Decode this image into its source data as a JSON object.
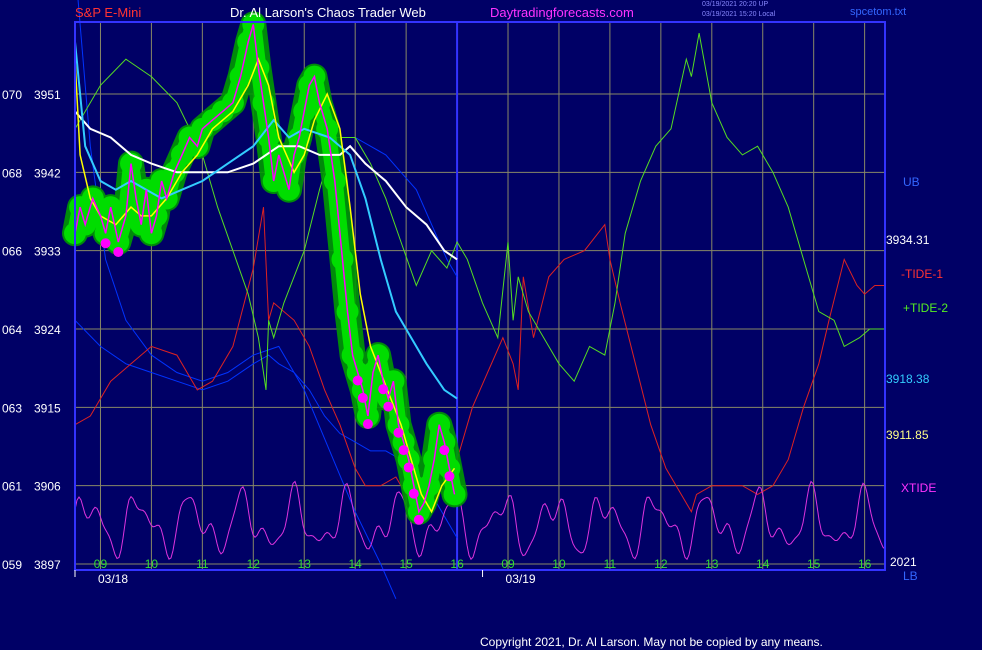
{
  "header": {
    "instrument": "S&P E-Mini",
    "title": "Dr. Al Larson's Chaos Trader Web",
    "site": "Daytradingforecasts.com",
    "stamp_line1": "03/19/2021 20:20 UP",
    "stamp_line2": "03/19/2021 15:20 Local",
    "filename": "spcetom.txt"
  },
  "footer": {
    "copyright": "Copyright 2021, Dr. Al Larson. May not be copied by any means."
  },
  "colors": {
    "background": "#000066",
    "plot_border": "#3333ff",
    "grid": "#888866",
    "price": "#ff00ff",
    "glow": "#00dd00",
    "glow_dark": "#009900",
    "yellow_avg": "#ffff00",
    "cyan_avg": "#33ccff",
    "white_avg": "#ffffff",
    "band": "#0033ff",
    "tide1": "#dd2222",
    "tide2": "#55dd22",
    "xtide": "#dd33dd"
  },
  "chart_data": {
    "type": "line",
    "y_axis": {
      "ticks": [
        {
          "left": "070",
          "right": "3951",
          "value": 3951
        },
        {
          "left": "068",
          "right": "3942",
          "value": 3942
        },
        {
          "left": "066",
          "right": "3933",
          "value": 3933
        },
        {
          "left": "064",
          "right": "3924",
          "value": 3924
        },
        {
          "left": "063",
          "right": "3915",
          "value": 3915
        },
        {
          "left": "061",
          "right": "3906",
          "value": 3906
        },
        {
          "left": "059",
          "right": "3897",
          "value": 3897
        }
      ],
      "ylim": [
        3897,
        3951
      ]
    },
    "x_axis": {
      "ticks": [
        "09",
        "10",
        "11",
        "12",
        "13",
        "14",
        "15",
        "16",
        "09",
        "10",
        "11",
        "12",
        "13",
        "14",
        "15",
        "16"
      ],
      "date_labels": [
        {
          "label": "03/18",
          "hour": 8.5
        },
        {
          "label": "03/19",
          "hour": 16.5
        }
      ],
      "xlim": [
        8.5,
        24.4
      ]
    },
    "right_labels": {
      "ub": "UB",
      "v1": "3934.31",
      "tide1": "-TIDE-1",
      "tide2": "+TIDE-2",
      "v2": "3918.38",
      "v3": "3911.85",
      "xtide": "XTIDE",
      "year": "2021",
      "lb": "LB"
    },
    "series": [
      {
        "key": "price",
        "x": [
          8.5,
          8.6,
          8.7,
          8.85,
          9.0,
          9.1,
          9.2,
          9.35,
          9.5,
          9.6,
          9.7,
          9.8,
          9.9,
          10.0,
          10.1,
          10.2,
          10.3,
          10.45,
          10.6,
          10.75,
          10.9,
          11.0,
          11.2,
          11.4,
          11.6,
          11.75,
          11.9,
          12.0,
          12.1,
          12.2,
          12.3,
          12.4,
          12.5,
          12.6,
          12.7,
          12.8,
          12.9,
          13.0,
          13.1,
          13.2,
          13.3,
          13.45,
          13.6,
          13.75,
          13.85,
          13.95,
          14.05,
          14.15,
          14.25,
          14.35,
          14.45,
          14.55,
          14.65,
          14.75,
          14.85,
          14.95,
          15.05,
          15.15,
          15.25,
          15.35,
          15.45,
          15.55,
          15.65,
          15.75,
          15.85,
          15.95
        ],
        "y": [
          3935,
          3938,
          3936,
          3939,
          3937,
          3935,
          3938,
          3934,
          3937,
          3943,
          3939,
          3936,
          3940,
          3935,
          3937,
          3941,
          3939,
          3942,
          3944,
          3946,
          3945,
          3947,
          3948,
          3949,
          3950,
          3953,
          3957,
          3959,
          3954,
          3950,
          3946,
          3941,
          3944,
          3942,
          3940,
          3944,
          3946,
          3949,
          3952,
          3953,
          3950,
          3947,
          3941,
          3932,
          3926,
          3921,
          3919,
          3917,
          3914,
          3919,
          3921,
          3918,
          3916,
          3918,
          3913,
          3911,
          3909,
          3906,
          3903,
          3904,
          3906,
          3909,
          3913,
          3911,
          3908,
          3905
        ]
      },
      {
        "key": "yellow",
        "x": [
          8.5,
          8.6,
          8.8,
          9.0,
          9.3,
          9.6,
          9.8,
          10.0,
          10.3,
          10.6,
          10.9,
          11.2,
          11.6,
          11.9,
          12.1,
          12.3,
          12.5,
          12.8,
          13.0,
          13.2,
          13.45,
          13.7,
          13.9,
          14.1,
          14.3,
          14.5,
          14.7,
          14.9,
          15.1,
          15.3,
          15.5,
          15.7,
          15.95
        ],
        "y": [
          3955,
          3944,
          3939,
          3937,
          3936,
          3938,
          3937,
          3937,
          3939,
          3942,
          3944,
          3947,
          3949,
          3952,
          3955,
          3952,
          3946,
          3942,
          3944,
          3948,
          3951,
          3947,
          3938,
          3928,
          3922,
          3919,
          3916,
          3913,
          3909,
          3905,
          3903,
          3906,
          3908
        ]
      },
      {
        "key": "cyan",
        "x": [
          8.5,
          8.7,
          9.0,
          9.3,
          9.6,
          9.9,
          10.2,
          10.6,
          11.0,
          11.5,
          12.0,
          12.4,
          12.7,
          13.0,
          13.5,
          13.9,
          14.2,
          14.5,
          14.8,
          15.1,
          15.4,
          15.75,
          16.0
        ],
        "y": [
          3957,
          3945,
          3941,
          3940,
          3941,
          3940,
          3939,
          3940,
          3941,
          3943,
          3945,
          3948,
          3946,
          3947,
          3946,
          3944,
          3939,
          3932,
          3926,
          3923,
          3920,
          3917,
          3916
        ]
      },
      {
        "key": "white",
        "x": [
          8.5,
          8.8,
          9.2,
          9.6,
          10.0,
          10.5,
          11.0,
          11.5,
          12.0,
          12.5,
          12.9,
          13.3,
          13.7,
          13.9,
          14.2,
          14.6,
          15.0,
          15.4,
          15.75,
          16.0
        ],
        "y": [
          3949,
          3947,
          3946,
          3944,
          3943,
          3942,
          3942,
          3942,
          3943,
          3945,
          3945,
          3944,
          3944,
          3945,
          3943,
          3941,
          3938,
          3936,
          3933,
          3932
        ]
      },
      {
        "key": "band_upper",
        "x": [
          14.0,
          14.3,
          14.6,
          14.9,
          15.2,
          15.5,
          15.8,
          16.0
        ],
        "y": [
          3946,
          3945,
          3944,
          3942,
          3940,
          3936,
          3932,
          3930
        ]
      },
      {
        "key": "band_lower",
        "x": [
          8.5,
          9.0,
          9.5,
          10.0,
          10.5,
          11.0,
          11.5,
          12.0,
          12.3,
          12.5,
          12.8,
          13.1,
          13.4,
          13.7,
          14.0,
          14.3,
          14.6,
          14.9,
          15.2,
          15.5,
          15.8,
          16.0
        ],
        "y": [
          3925,
          3922,
          3920,
          3919,
          3918,
          3917,
          3918,
          3920,
          3921,
          3920,
          3919,
          3917,
          3914,
          3912,
          3911,
          3910,
          3910,
          3909,
          3907,
          3905,
          3902,
          3900
        ]
      },
      {
        "key": "blue_outer",
        "x": [
          8.5,
          8.8,
          9.1,
          9.5,
          10.0,
          10.5,
          11.0,
          11.5,
          12.0,
          12.5,
          13.0,
          13.5,
          14.0,
          14.5,
          14.8
        ],
        "y": [
          3966,
          3945,
          3932,
          3925,
          3921,
          3919,
          3918,
          3919,
          3921,
          3922,
          3917,
          3910,
          3903,
          3897,
          3893
        ]
      },
      {
        "key": "tide1",
        "x": [
          8.5,
          8.8,
          9.2,
          9.6,
          10.0,
          10.5,
          10.9,
          11.2,
          11.6,
          12.0,
          12.2,
          12.3,
          12.4,
          12.6,
          12.8,
          13.1,
          13.4,
          13.7,
          14.0,
          14.2,
          14.5,
          14.8,
          15.1,
          15.4,
          15.7,
          16.0,
          16.3,
          16.6,
          16.9,
          17.1,
          17.2,
          17.3,
          17.5,
          17.8,
          18.1,
          18.5,
          18.9,
          19.0,
          19.2,
          19.5,
          19.8,
          20.1,
          20.4,
          20.6,
          20.7,
          21.0,
          21.3,
          21.6,
          21.9,
          22.2,
          22.5,
          22.8,
          23.1,
          23.3,
          23.6,
          23.85,
          24.0,
          24.2,
          24.4
        ],
        "y": [
          3913,
          3914,
          3918,
          3920,
          3922,
          3921,
          3917,
          3918,
          3922,
          3931,
          3938,
          3925,
          3927,
          3926,
          3925,
          3922,
          3917,
          3913,
          3908,
          3906,
          3906,
          3907,
          3904,
          3903,
          3906,
          3909,
          3915,
          3919,
          3923,
          3920,
          3917,
          3930,
          3923,
          3930,
          3932,
          3933,
          3936,
          3932,
          3927,
          3920,
          3913,
          3908,
          3905,
          3903,
          3905,
          3906,
          3906,
          3906,
          3905,
          3906,
          3909,
          3915,
          3920,
          3925,
          3932,
          3929,
          3928,
          3929,
          3929
        ]
      },
      {
        "key": "tide2",
        "x": [
          8.5,
          9.0,
          9.5,
          10.0,
          10.5,
          11.0,
          11.3,
          11.6,
          11.9,
          12.1,
          12.25,
          12.3,
          12.4,
          12.6,
          13.0,
          13.3,
          13.6,
          14.0,
          14.3,
          14.6,
          14.9,
          15.2,
          15.5,
          15.8,
          16.0,
          16.2,
          16.5,
          16.8,
          17.0,
          17.1,
          17.2,
          17.4,
          17.7,
          18.0,
          18.3,
          18.6,
          18.9,
          19.1,
          19.3,
          19.6,
          19.9,
          20.2,
          20.5,
          20.55,
          20.6,
          20.75,
          21.0,
          21.3,
          21.6,
          21.9,
          22.2,
          22.5,
          22.8,
          23.1,
          23.4,
          23.6,
          23.9,
          24.1,
          24.2,
          24.4
        ],
        "y": [
          3947,
          3952,
          3955,
          3953,
          3950,
          3944,
          3938,
          3933,
          3928,
          3923,
          3917,
          3925,
          3923,
          3927,
          3933,
          3940,
          3946,
          3946,
          3943,
          3939,
          3934,
          3929,
          3933,
          3931,
          3934,
          3932,
          3927,
          3923,
          3934,
          3925,
          3930,
          3926,
          3923,
          3920,
          3918,
          3922,
          3921,
          3927,
          3935,
          3941,
          3945,
          3947,
          3955,
          3954,
          3953,
          3958,
          3950,
          3946,
          3944,
          3945,
          3942,
          3938,
          3932,
          3926,
          3925,
          3922,
          3923,
          3924,
          3924,
          3924
        ]
      },
      {
        "key": "xtide_hidden",
        "x": [],
        "y": []
      }
    ]
  }
}
